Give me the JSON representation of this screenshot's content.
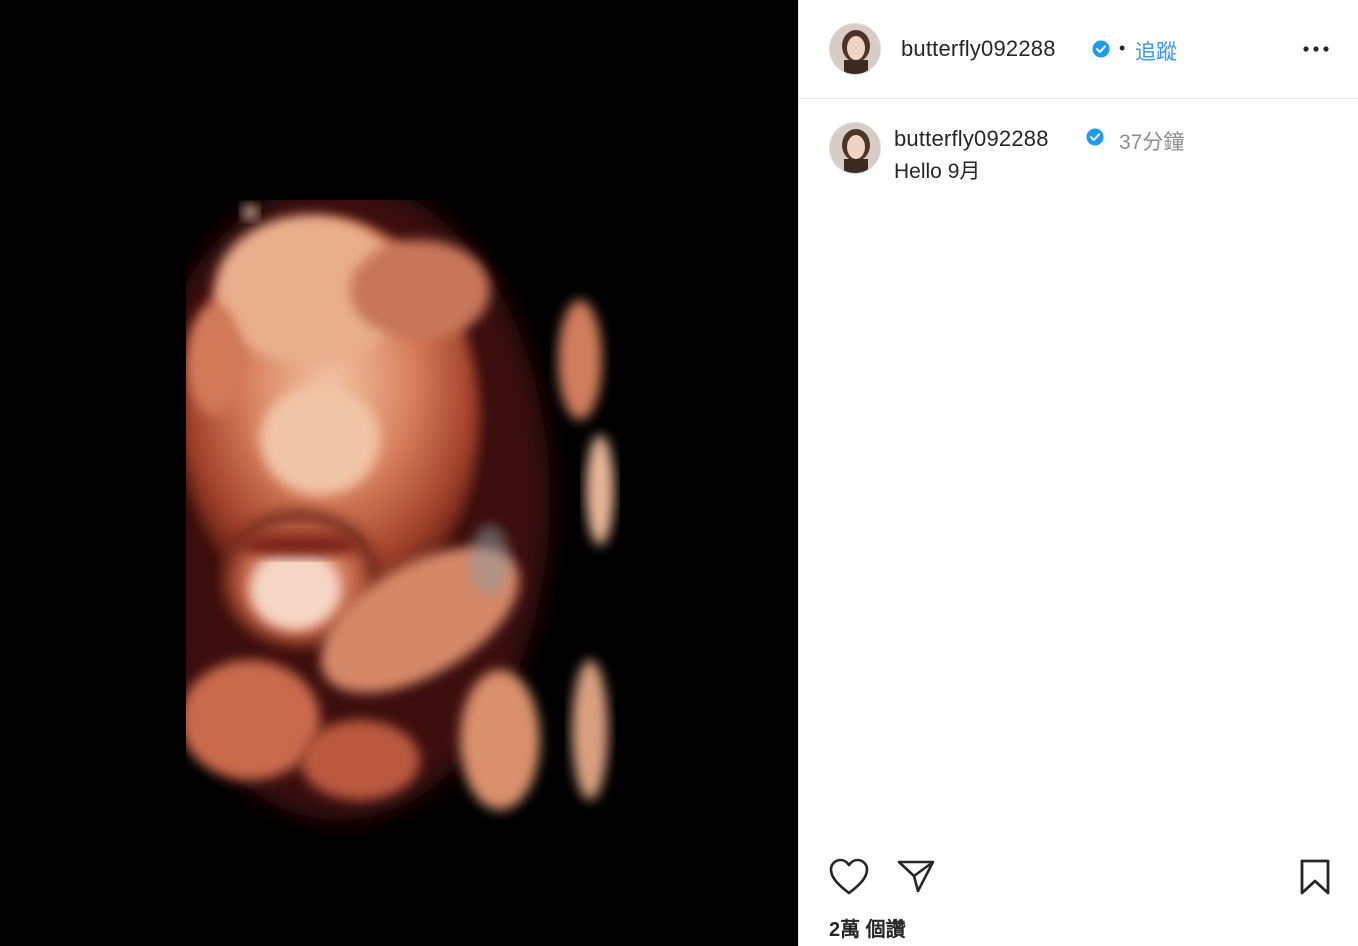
{
  "post": {
    "username": "butterfly092288",
    "verified": true,
    "follow_label": "追蹤",
    "separator": "•",
    "more_label": "...",
    "caption": {
      "username": "butterfly092288",
      "time": "37分鐘",
      "text": "Hello 9月"
    },
    "likes_text": "2萬 個讚"
  },
  "media": {
    "description": "3D ultrasound image on black background",
    "icon": "ultrasound-image"
  },
  "colors": {
    "accent": "#3897f0",
    "verified": "#1d9bf0",
    "text": "#262626",
    "secondary": "#8e8e8e",
    "media_bg": "#000000"
  },
  "icons": {
    "like": "heart-icon",
    "share": "paper-plane-icon",
    "save": "bookmark-icon",
    "more": "ellipsis-icon",
    "verified": "verified-badge-icon"
  }
}
